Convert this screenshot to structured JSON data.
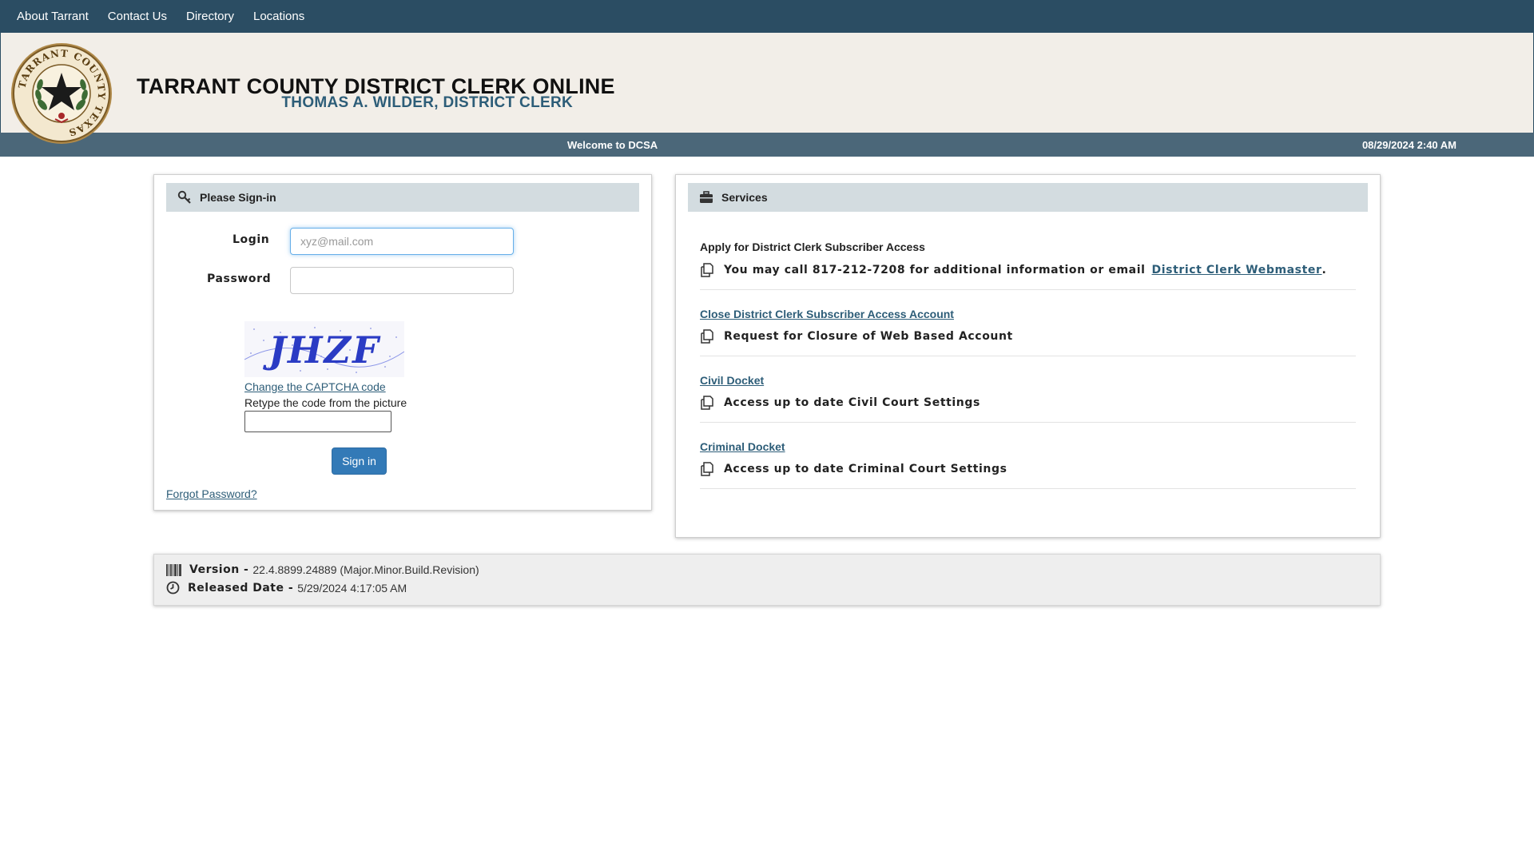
{
  "nav": {
    "items": [
      {
        "label": "About Tarrant"
      },
      {
        "label": "Contact Us"
      },
      {
        "label": "Directory"
      },
      {
        "label": "Locations"
      }
    ]
  },
  "header": {
    "title": "TARRANT COUNTY DISTRICT CLERK ONLINE",
    "subtitle": "THOMAS A. WILDER, DISTRICT CLERK",
    "seal_text": "TARRANT COUNTY TEXAS",
    "welcome": "Welcome to DCSA",
    "datetime": "08/29/2024 2:40 AM"
  },
  "signin": {
    "heading": "Please Sign-in",
    "login_label": "Login",
    "login_placeholder": "xyz@mail.com",
    "login_value": "",
    "password_label": "Password",
    "password_value": "",
    "captcha_text": "JHZF",
    "captcha_change": "Change the CAPTCHA code",
    "captcha_hint": "Retype the code from the picture",
    "captcha_value": "",
    "signin_button": "Sign in",
    "forgot": "Forgot Password?"
  },
  "services": {
    "heading": "Services",
    "items": [
      {
        "title": "Apply for District Clerk Subscriber Access",
        "desc": "You may call 817-212-7208 for additional information or email",
        "link": "District Clerk Webmaster",
        "tail": "."
      },
      {
        "title": "Close District Clerk Subscriber Access Account",
        "desc": "Request for Closure of Web Based Account"
      },
      {
        "title": "Civil Docket",
        "desc": "Access up to date Civil Court Settings"
      },
      {
        "title": "Criminal Docket",
        "desc": "Access up to date Criminal Court Settings"
      }
    ]
  },
  "footer": {
    "version_label": "Version -",
    "version_value": "22.4.8899.24889 (Major.Minor.Build.Revision)",
    "released_label": "Released Date -",
    "released_value": "5/29/2024 4:17:05 AM"
  },
  "colors": {
    "nav_bg": "#2b4d63",
    "header_bg": "#f2eee8",
    "welcome_bar": "#4b6779",
    "link": "#2d5d78",
    "button": "#337ab7",
    "panel_head": "#d3dce0"
  },
  "icons": [
    "key-icon",
    "briefcase-icon",
    "copy-icon",
    "barcode-icon",
    "clock-icon",
    "county-seal"
  ]
}
